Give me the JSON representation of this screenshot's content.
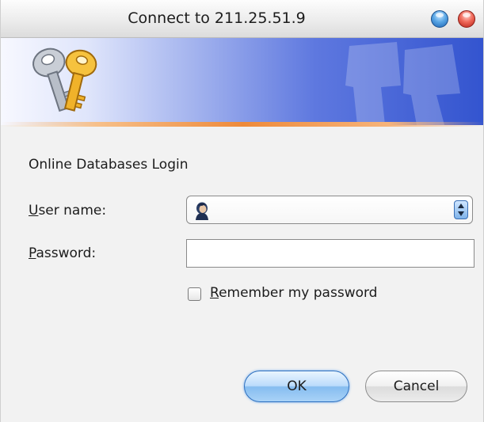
{
  "window": {
    "title": "Connect to 211.25.51.9"
  },
  "banner": {
    "icon": "keys-icon"
  },
  "form": {
    "heading": "Online Databases Login",
    "user_label_mnemonic": "U",
    "user_label_rest": "ser name:",
    "user_value": "",
    "password_label_mnemonic": "P",
    "password_label_rest": "assword:",
    "password_value": "",
    "remember_mnemonic": "R",
    "remember_rest": "emember my password",
    "remember_checked": false
  },
  "buttons": {
    "ok": "OK",
    "cancel": "Cancel"
  },
  "colors": {
    "banner_accent": "#3354cf",
    "ok_border": "#2c6fbf",
    "close_button": "#f06a5a",
    "minimize_button": "#5aa7e6"
  }
}
